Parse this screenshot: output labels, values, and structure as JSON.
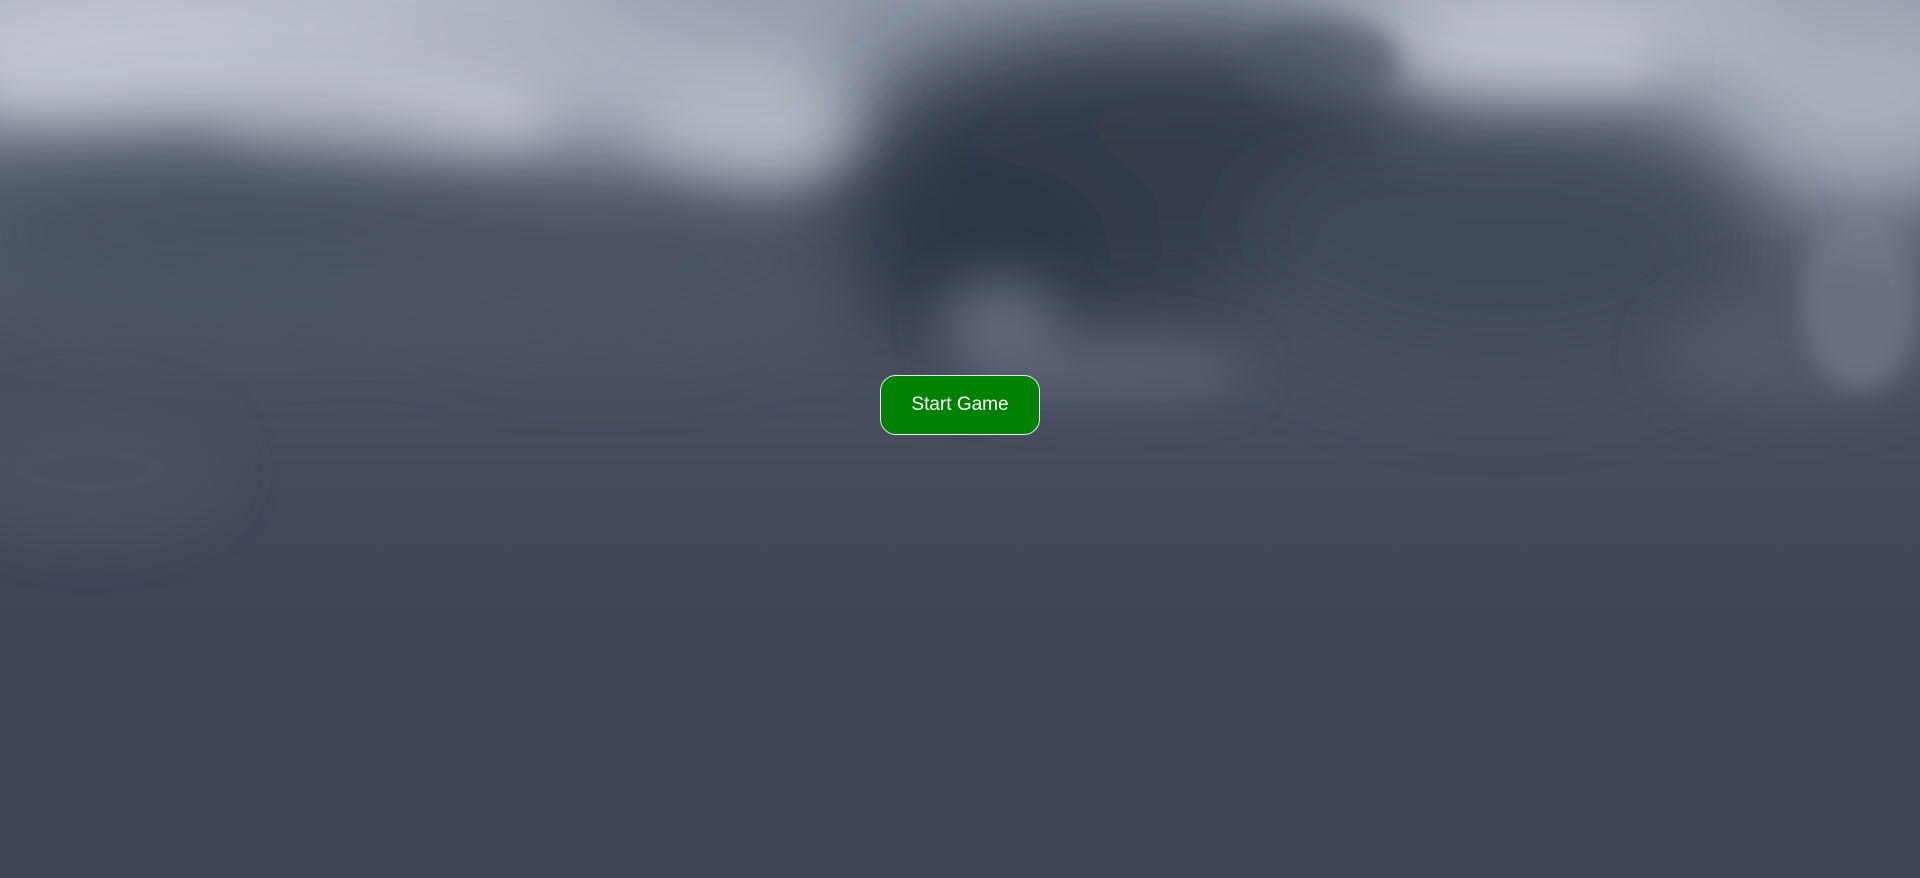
{
  "scene": {
    "background": "stormy-clouds-sky"
  },
  "start_button": {
    "label": "Start Game",
    "color": "#008000",
    "text_color": "#ffffff"
  }
}
